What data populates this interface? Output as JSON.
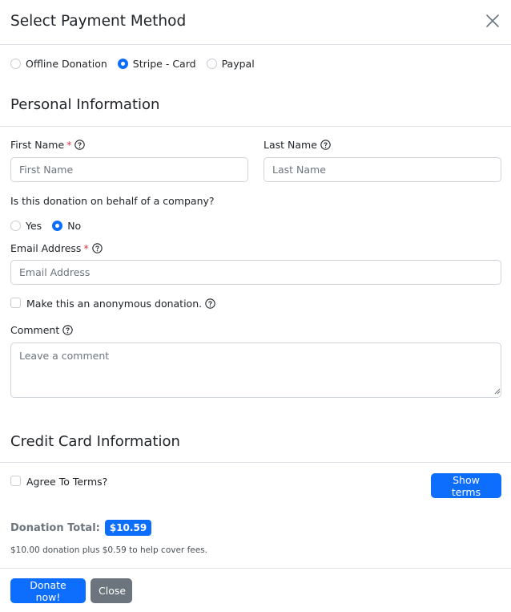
{
  "modal": {
    "title": "Select Payment Method"
  },
  "payment_methods": [
    {
      "label": "Offline Donation",
      "selected": false
    },
    {
      "label": "Stripe - Card",
      "selected": true
    },
    {
      "label": "Paypal",
      "selected": false
    }
  ],
  "personal": {
    "section_title": "Personal Information",
    "first_name": {
      "label": "First Name",
      "required_mark": "*",
      "placeholder": "First Name",
      "value": ""
    },
    "last_name": {
      "label": "Last Name",
      "placeholder": "Last Name",
      "value": ""
    },
    "company_question": "Is this donation on behalf of a company?",
    "company_options": [
      {
        "label": "Yes",
        "selected": false
      },
      {
        "label": "No",
        "selected": true
      }
    ],
    "email": {
      "label": "Email Address",
      "required_mark": "*",
      "placeholder": "Email Address",
      "value": ""
    },
    "anonymous_label": "Make this an anonymous donation.",
    "anonymous_checked": false,
    "comment": {
      "label": "Comment",
      "placeholder": "Leave a comment",
      "value": ""
    }
  },
  "credit_card": {
    "section_title": "Credit Card Information",
    "terms_label": "Agree To Terms?",
    "terms_checked": false,
    "show_terms_label": "Show terms"
  },
  "donation": {
    "total_label": "Donation Total:",
    "total_amount": "$10.59",
    "fee_note": "$10.00 donation plus $0.59 to help cover fees."
  },
  "footer": {
    "donate_label": "Donate now!",
    "close_label": "Close"
  },
  "colors": {
    "primary": "#0d6efd",
    "secondary": "#6c757d",
    "required": "#dc3545"
  }
}
